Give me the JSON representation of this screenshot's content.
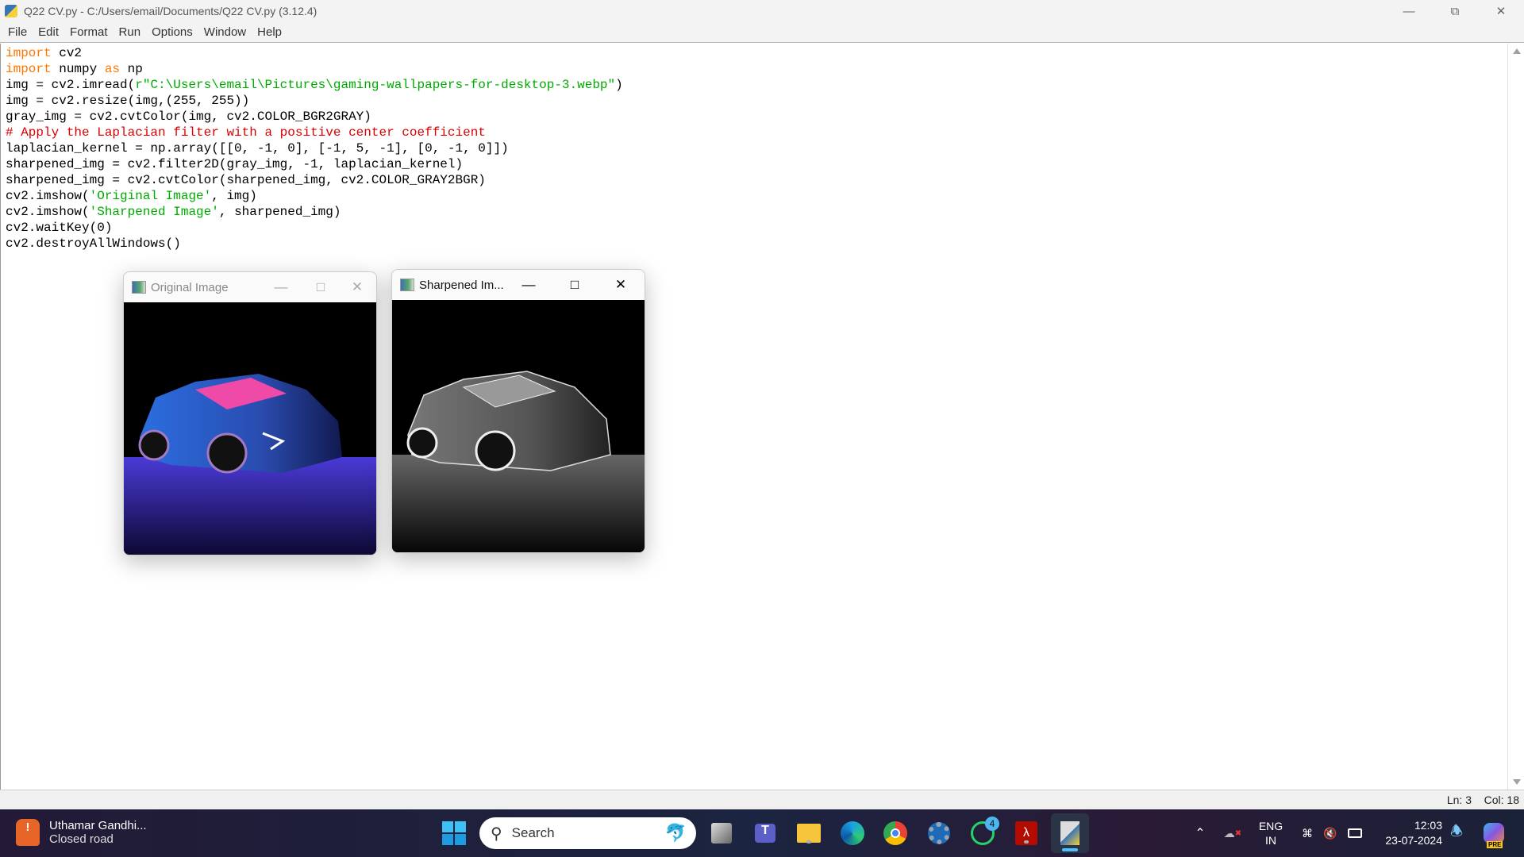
{
  "window": {
    "title": "Q22 CV.py - C:/Users/email/Documents/Q22 CV.py (3.12.4)"
  },
  "menu": [
    "File",
    "Edit",
    "Format",
    "Run",
    "Options",
    "Window",
    "Help"
  ],
  "code": [
    [
      [
        "import",
        "kw"
      ],
      [
        " cv2",
        ""
      ]
    ],
    [
      [
        "import",
        "kw"
      ],
      [
        " numpy ",
        ""
      ],
      [
        "as",
        "kw"
      ],
      [
        " np",
        ""
      ]
    ],
    [
      [
        "img = cv2.imread(",
        ""
      ],
      [
        "r\"C:\\Users\\email\\Pictures\\gaming-wallpapers-for-desktop-3.webp\"",
        "str"
      ],
      [
        ")",
        ""
      ]
    ],
    [
      [
        "img = cv2.resize(img,(255, 255))",
        ""
      ]
    ],
    [
      [
        "gray_img = cv2.cvtColor(img, cv2.COLOR_BGR2GRAY)",
        ""
      ]
    ],
    [
      [
        "# Apply the Laplacian filter with a positive center coefficient",
        "com"
      ]
    ],
    [
      [
        "laplacian_kernel = np.array([[0, -1, 0], [-1, 5, -1], [0, -1, 0]])",
        ""
      ]
    ],
    [
      [
        "sharpened_img = cv2.filter2D(gray_img, -1, laplacian_kernel)",
        ""
      ]
    ],
    [
      [
        "sharpened_img = cv2.cvtColor(sharpened_img, cv2.COLOR_GRAY2BGR)",
        ""
      ]
    ],
    [
      [
        "cv2.imshow(",
        ""
      ],
      [
        "'Original Image'",
        "str"
      ],
      [
        ", img)",
        ""
      ]
    ],
    [
      [
        "cv2.imshow(",
        ""
      ],
      [
        "'Sharpened Image'",
        "str"
      ],
      [
        ", sharpened_img)",
        ""
      ]
    ],
    [
      [
        "cv2.waitKey(0)",
        ""
      ]
    ],
    [
      [
        "cv2.destroyAllWindows()",
        ""
      ]
    ]
  ],
  "status": {
    "line": "Ln: 3",
    "col": "Col: 18"
  },
  "cv_windows": {
    "original": {
      "title": "Original Image"
    },
    "sharpened": {
      "title": "Sharpened Im..."
    }
  },
  "taskbar": {
    "weather": {
      "title": "Uthamar Gandhi...",
      "subtitle": "Closed road"
    },
    "search_placeholder": "Search",
    "whatsapp_badge": "4",
    "lang": {
      "line1": "ENG",
      "line2": "IN"
    },
    "clock": {
      "time": "12:03",
      "date": "23-07-2024"
    },
    "copilot_badge": "PRE"
  }
}
